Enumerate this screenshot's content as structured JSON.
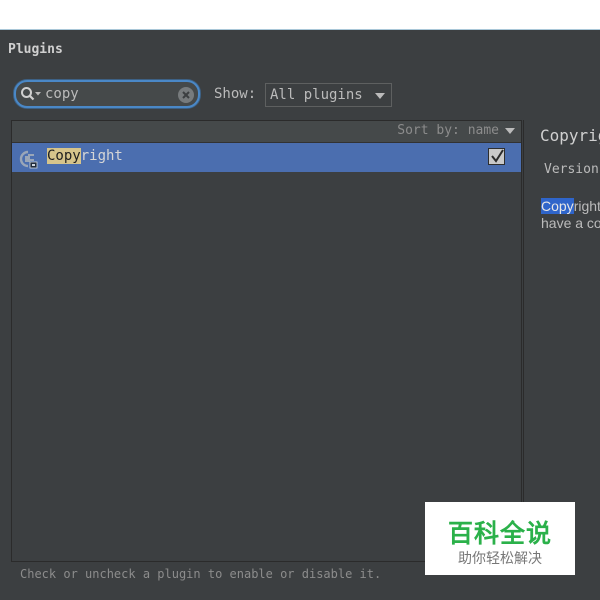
{
  "dialog": {
    "title": "Plugins"
  },
  "search": {
    "value": "copy"
  },
  "filter": {
    "show_label": "Show:",
    "selected": "All plugins"
  },
  "list": {
    "sort_label": "Sort by: name",
    "plugins": [
      {
        "name_highlight": "Copy",
        "name_rest": "right",
        "enabled": true
      }
    ]
  },
  "detail": {
    "name": "Copyright",
    "version_label": "Version",
    "desc_highlight": "Copy",
    "desc_line1_rest": "right",
    "desc_line2": "have a co"
  },
  "status": {
    "hint": "Check or uncheck a plugin to enable or disable it."
  },
  "watermark": {
    "main": "百科全说",
    "sub": "助你轻松解决"
  },
  "colors": {
    "background": "#3c3f41",
    "selection": "#4b6eaf",
    "search_focus": "#4a88c7",
    "match_highlight": "#d6c48b",
    "watermark_green": "#2bb14a"
  }
}
